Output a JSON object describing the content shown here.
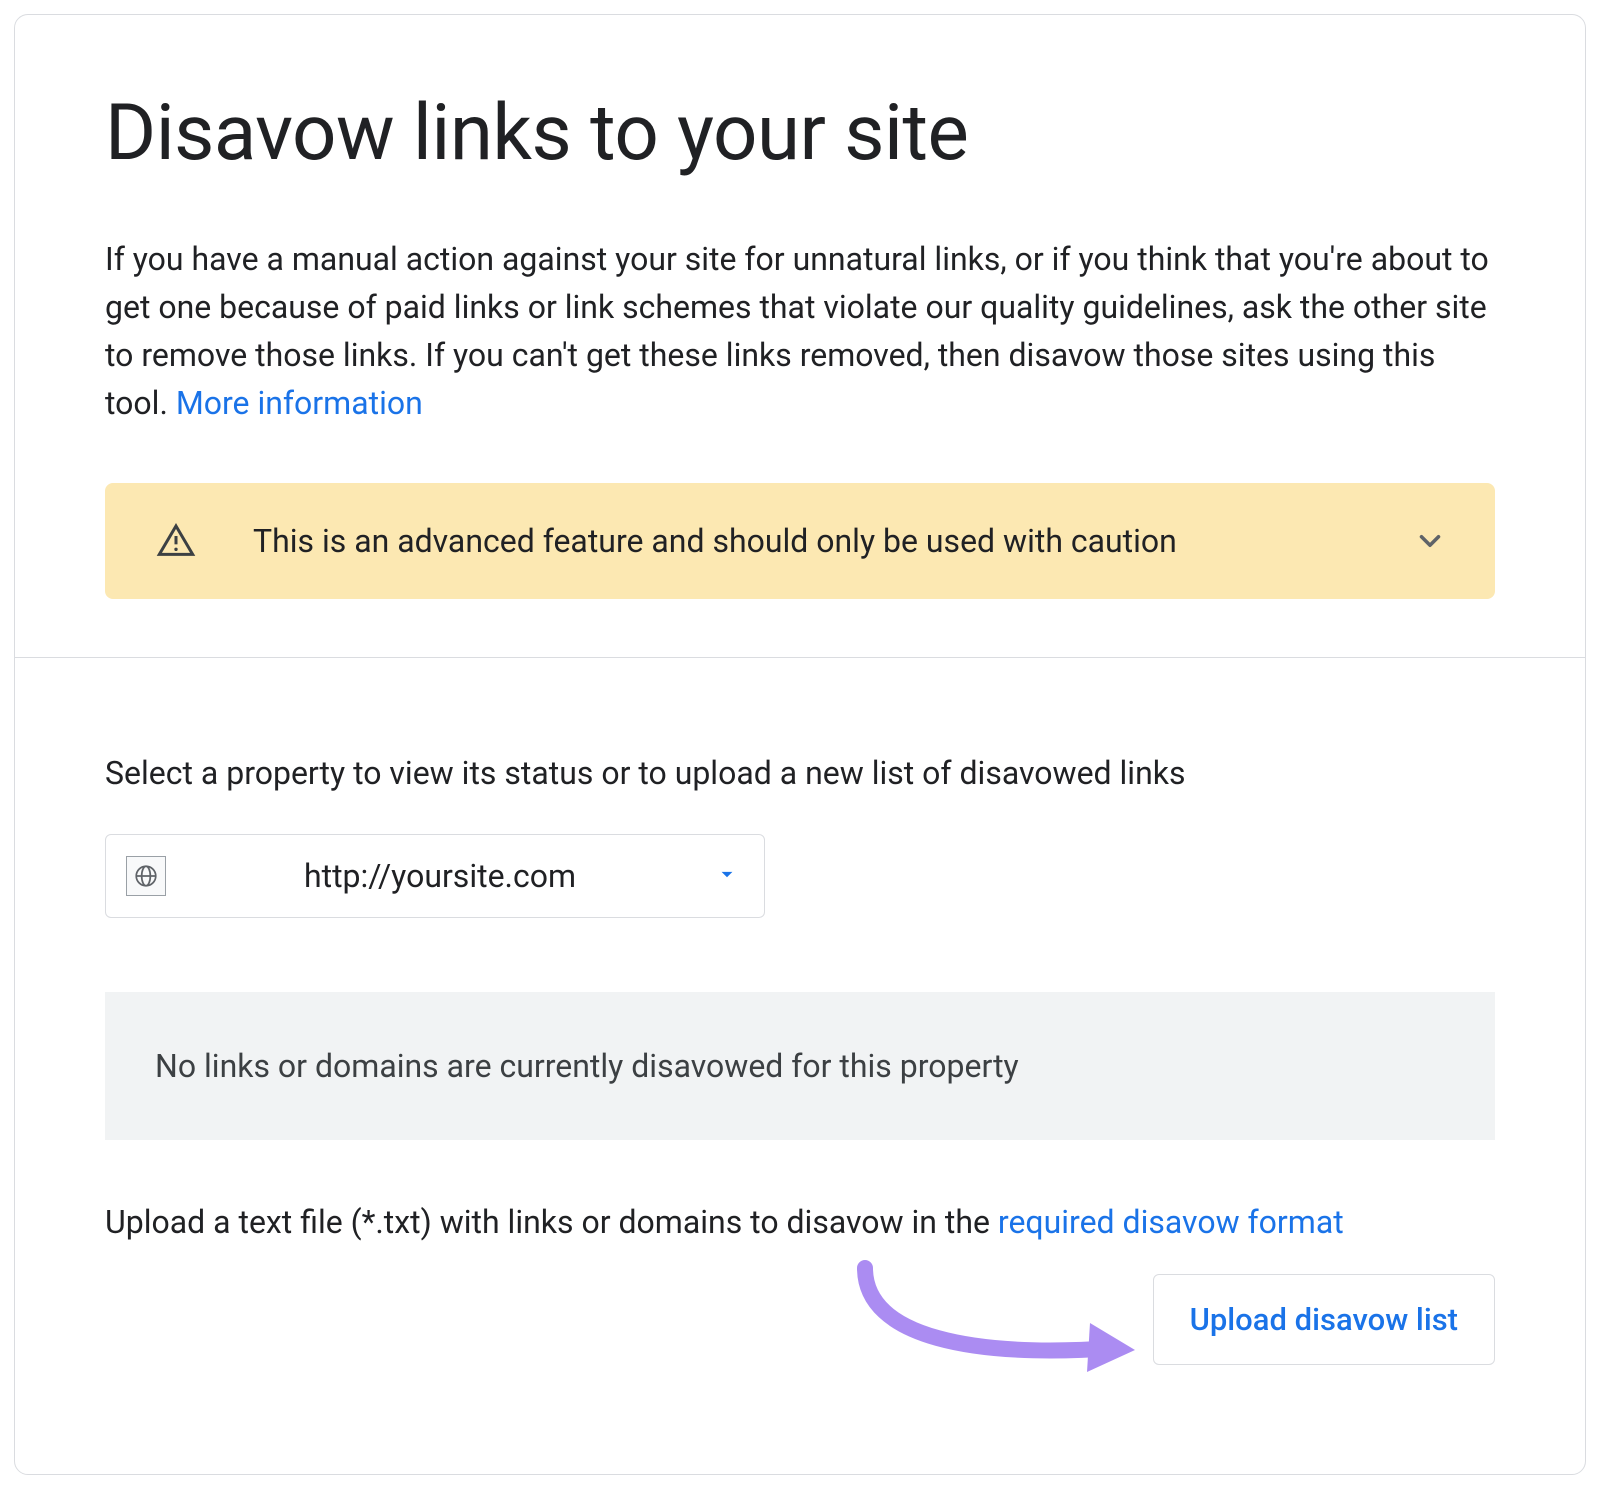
{
  "page": {
    "title": "Disavow links to your site",
    "intro": "If you have a manual action against your site for unnatural links, or if you think that you're about to get one because of paid links or link schemes that violate our quality guidelines, ask the other site to remove those links. If you can't get these links removed, then disavow those sites using this tool. ",
    "more_info_label": "More information"
  },
  "alert": {
    "text": "This is an advanced feature and should only be used with caution"
  },
  "property_section": {
    "label": "Select a property to view its status or to upload a new list of disavowed links",
    "selected_property": "http://yoursite.com"
  },
  "status_panel": {
    "text": "No links or domains are currently disavowed for this property"
  },
  "upload": {
    "prefix": "Upload a text file (*.txt) with links or domains to disavow in the ",
    "link_label": "required disavow format",
    "button_label": "Upload disavow list"
  },
  "colors": {
    "link": "#1a73e8",
    "alert_bg": "#fce8b2",
    "panel_bg": "#f1f3f4",
    "border": "#dadce0",
    "annotation": "#b794f4"
  }
}
